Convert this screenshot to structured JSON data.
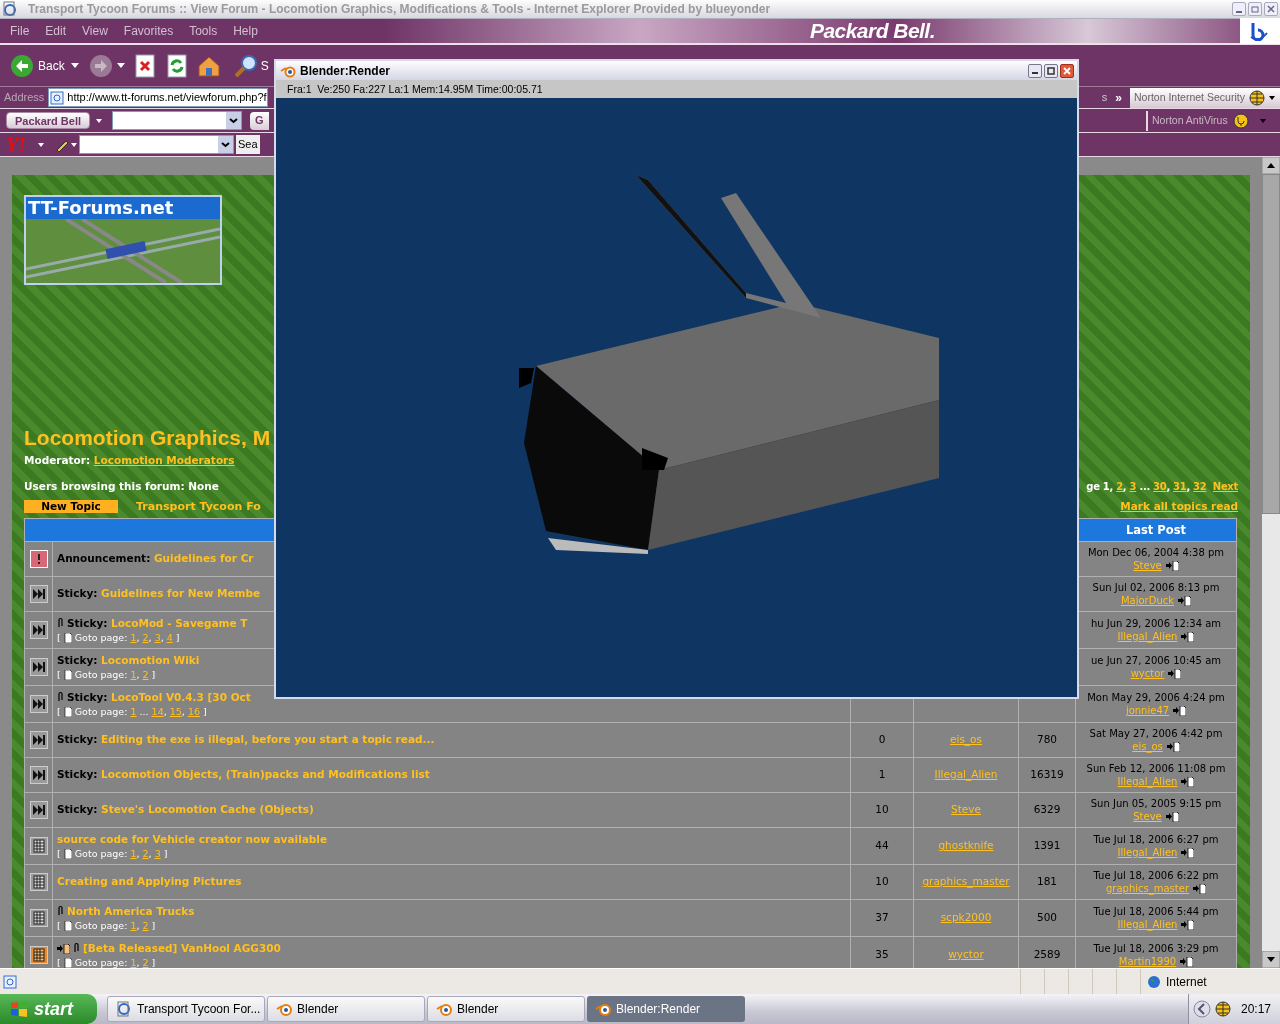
{
  "window": {
    "title": "Transport Tycoon Forums :: View Forum - Locomotion Graphics, Modifications & Tools - Internet Explorer Provided by blueyonder",
    "active": false
  },
  "menu": [
    {
      "label": "File",
      "disabled": true
    },
    {
      "label": "Edit",
      "disabled": true
    },
    {
      "label": "View",
      "disabled": true
    },
    {
      "label": "Favorites",
      "disabled": true
    },
    {
      "label": "Tools",
      "disabled": true
    },
    {
      "label": "Help",
      "disabled": true
    }
  ],
  "branding": {
    "logo": "Packard Bell."
  },
  "toolbar": {
    "back": "Back",
    "search": "S"
  },
  "address": {
    "label": "Address",
    "url": "http://www.tt-forums.net/viewforum.php?f",
    "links": "s",
    "chevron": "»",
    "norton_security": "Norton Internet Security"
  },
  "pb_toolbar": {
    "button": "Packard Bell",
    "go": "G",
    "norton_antivirus": "Norton AntiVirus"
  },
  "yahoo_toolbar": {
    "logo": "Y!",
    "search": "Sea"
  },
  "forum": {
    "site_logo": "TT-Forums.net",
    "title": "Locomotion Graphics, M",
    "moderator_label": "Moderator:",
    "moderator": "Locomotion Moderators",
    "users_browsing": "Users browsing this forum: None",
    "new_topic": "New Topic",
    "breadcrumb": "Transport Tycoon Fo",
    "pagination": {
      "prefix": "ge",
      "pages": [
        {
          "t": "1",
          "current": true,
          "after": ", "
        },
        {
          "t": "2",
          "current": false,
          "after": ", "
        },
        {
          "t": "3",
          "current": false,
          "after": " ... "
        },
        {
          "t": "30",
          "current": false,
          "after": ", "
        },
        {
          "t": "31",
          "current": false,
          "after": ", "
        },
        {
          "t": "32",
          "current": false
        }
      ],
      "next": "Next"
    },
    "mark_read": "Mark all topics read",
    "last_post_header": "Last Post",
    "topics": [
      {
        "kind": "announcement",
        "attachment": false,
        "new_post": false,
        "prefix": "Announcement:",
        "title": "Guidelines for Cr",
        "last_post": {
          "date": "Mon Dec 06, 2004 4:38 pm",
          "author": "Steve"
        }
      },
      {
        "kind": "sticky",
        "attachment": false,
        "new_post": false,
        "prefix": "Sticky:",
        "title": "Guidelines for New Membe",
        "last_post": {
          "date": "Sun Jul 02, 2006 8:13 pm",
          "author": "MajorDuck"
        }
      },
      {
        "kind": "sticky",
        "attachment": true,
        "new_post": false,
        "prefix": "Sticky:",
        "title": "LocoMod - Savegame T",
        "goto": {
          "open": "[",
          "label": "Goto page:",
          "pages": [
            {
              "t": "1",
              "after": ", "
            },
            {
              "t": "2",
              "after": ", "
            },
            {
              "t": "3",
              "after": ", "
            },
            {
              "t": "4"
            }
          ],
          "close": "]"
        },
        "last_post": {
          "date": "hu Jun 29, 2006 12:34 am",
          "author": "Illegal_Alien"
        }
      },
      {
        "kind": "sticky",
        "attachment": false,
        "new_post": false,
        "prefix": "Sticky:",
        "title": "Locomotion Wiki",
        "goto": {
          "open": "[",
          "label": "Goto page:",
          "pages": [
            {
              "t": "1",
              "after": ", "
            },
            {
              "t": "2"
            }
          ],
          "close": "]"
        },
        "last_post": {
          "date": "ue Jun 27, 2006 10:45 am",
          "author": "wyctor"
        }
      },
      {
        "kind": "sticky",
        "attachment": true,
        "new_post": false,
        "prefix": "Sticky:",
        "title": "LocoTool V0.4.3 [30 Oct",
        "goto": {
          "open": "[",
          "label": "Goto page:",
          "pages": [
            {
              "t": "1",
              "after": " ... "
            },
            {
              "t": "14",
              "after": ", "
            },
            {
              "t": "15",
              "after": ", "
            },
            {
              "t": "16"
            }
          ],
          "close": "]"
        },
        "last_post": {
          "date": "Mon May 29, 2006 4:24 pm",
          "author": "jonnie47"
        }
      },
      {
        "kind": "sticky",
        "attachment": false,
        "new_post": false,
        "prefix": "Sticky:",
        "title": "Editing the exe is illegal, before you start a topic read...",
        "replies": "0",
        "author": "eis_os",
        "views": "780",
        "last_post": {
          "date": "Sat May 27, 2006 4:42 pm",
          "author": "eis_os"
        }
      },
      {
        "kind": "sticky",
        "attachment": false,
        "new_post": false,
        "prefix": "Sticky:",
        "title": "Locomotion Objects, (Train)packs and Modifications list",
        "replies": "1",
        "author": "Illegal_Alien",
        "views": "16319",
        "last_post": {
          "date": "Sun Feb 12, 2006 11:08 pm",
          "author": "Illegal_Alien"
        }
      },
      {
        "kind": "sticky",
        "attachment": false,
        "new_post": false,
        "prefix": "Sticky:",
        "title": "Steve's Locomotion Cache (Objects)",
        "replies": "10",
        "author": "Steve",
        "views": "6329",
        "last_post": {
          "date": "Sun Jun 05, 2005 9:15 pm",
          "author": "Steve"
        }
      },
      {
        "kind": "hot",
        "attachment": false,
        "new_post": false,
        "title": "source code for Vehicle creator now available",
        "goto": {
          "open": "[",
          "label": "Goto page:",
          "pages": [
            {
              "t": "1",
              "after": ", "
            },
            {
              "t": "2",
              "after": ", "
            },
            {
              "t": "3"
            }
          ],
          "close": "]"
        },
        "replies": "44",
        "author": "ghostknife",
        "views": "1391",
        "last_post": {
          "date": "Tue Jul 18, 2006 6:27 pm",
          "author": "Illegal_Alien"
        }
      },
      {
        "kind": "hot",
        "attachment": false,
        "new_post": false,
        "title": "Creating and Applying Pictures",
        "replies": "10",
        "author": "graphics_master",
        "views": "181",
        "last_post": {
          "date": "Tue Jul 18, 2006 6:22 pm",
          "author": "graphics_master"
        }
      },
      {
        "kind": "hot",
        "attachment": true,
        "new_post": false,
        "title": "North America Trucks",
        "goto": {
          "open": "[",
          "label": "Goto page:",
          "pages": [
            {
              "t": "1",
              "after": ", "
            },
            {
              "t": "2"
            }
          ],
          "close": "]"
        },
        "replies": "37",
        "author": "scpk2000",
        "views": "500",
        "last_post": {
          "date": "Tue Jul 18, 2006 5:44 pm",
          "author": "Illegal_Alien"
        }
      },
      {
        "kind": "hot_new",
        "attachment": true,
        "new_post": true,
        "title": "[Beta Released] VanHool AGG300",
        "goto": {
          "open": "[",
          "label": "Goto page:",
          "pages": [
            {
              "t": "1",
              "after": ", "
            },
            {
              "t": "2"
            }
          ],
          "close": "]"
        },
        "replies": "35",
        "author": "wyctor",
        "views": "2589",
        "last_post": {
          "date": "Tue Jul 18, 2006 3:29 pm",
          "author": "Martin1990"
        }
      }
    ]
  },
  "blender": {
    "title": "Blender:Render",
    "stats": "Fra:1  Ve:250 Fa:227 La:1 Mem:14.95M Time:00:05.71"
  },
  "status_bar": {
    "zone": "Internet"
  },
  "taskbar": {
    "start": "start",
    "buttons": [
      {
        "label": "Transport Tycoon For...",
        "kind": "ie",
        "selected": false
      },
      {
        "label": "Blender",
        "kind": "blender",
        "selected": false
      },
      {
        "label": "Blender",
        "kind": "blender",
        "selected": false
      },
      {
        "label": "Blender:Render",
        "kind": "blender",
        "selected": true
      }
    ],
    "clock": "20:17"
  }
}
